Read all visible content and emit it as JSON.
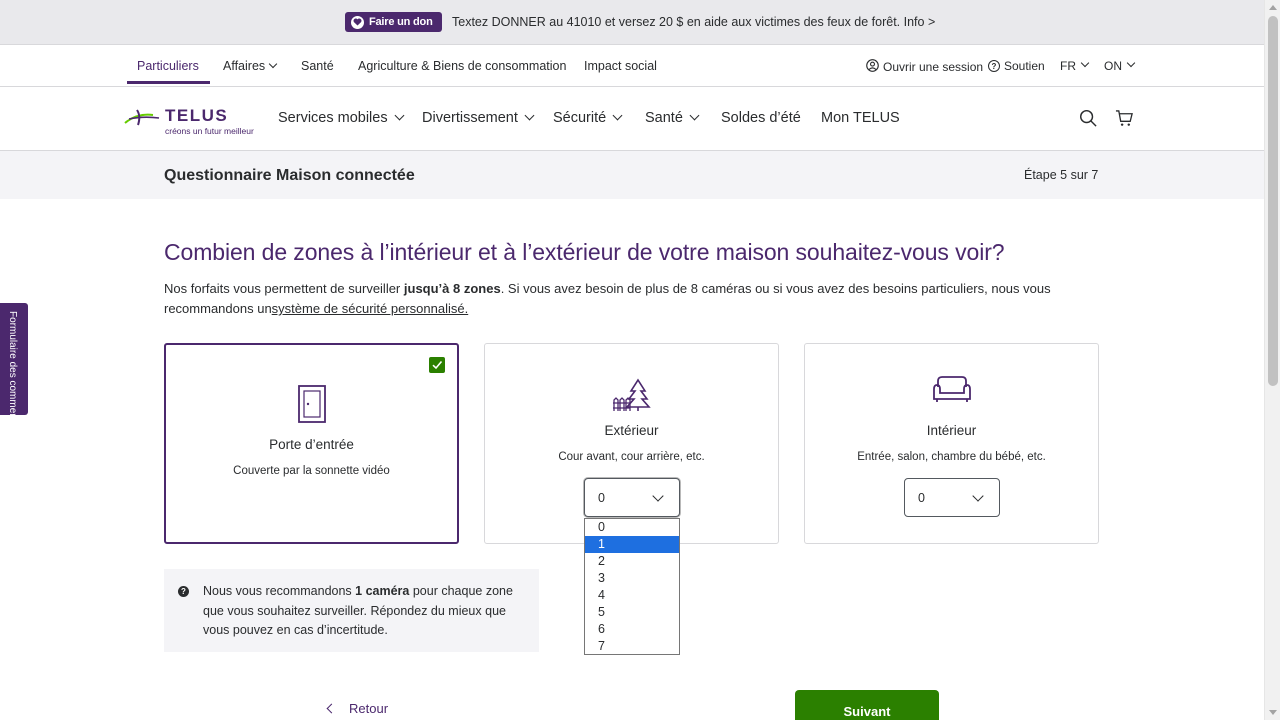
{
  "promo": {
    "donate_label": "Faire un don",
    "message": "Textez DONNER au 41010 et versez 20 $ en aide aux victimes des feux de forêt. Info >"
  },
  "subnav": {
    "items": [
      "Particuliers",
      "Affaires",
      "Santé",
      "Agriculture & Biens de consommation",
      "Impact social"
    ],
    "login": "Ouvrir une session",
    "support": "Soutien",
    "language": "FR",
    "province": "ON"
  },
  "brand": {
    "name": "TELUS",
    "tagline": "créons un futur meilleur",
    "accent": "#4b286d",
    "green": "#2b8000"
  },
  "mainnav": {
    "items": [
      "Services mobiles",
      "Divertissement",
      "Sécurité",
      "Santé",
      "Soldes d’été",
      "Mon TELUS"
    ]
  },
  "questionnaire": {
    "title": "Questionnaire Maison connectée",
    "step": "Étape 5 sur 7"
  },
  "content": {
    "heading": "Combien de zones à l’intérieur et à l’extérieur de votre maison souhaitez-vous voir?",
    "intro_before": "Nos forfaits vous permettent de surveiller ",
    "intro_bold": "jusqu’à 8 zones",
    "intro_after": ". Si vous avez besoin de plus de 8 caméras ou si vous avez des besoins particuliers, nous vous recommandons un",
    "intro_link": "système de sécurité personnalisé."
  },
  "cards": [
    {
      "icon": "door-icon",
      "title": "Porte d’entrée",
      "subtitle": "Couverte par la sonnette vidéo",
      "selected": true
    },
    {
      "icon": "trees-fence-icon",
      "title": "Extérieur",
      "subtitle": "Cour avant, cour arrière, etc.",
      "value": "0"
    },
    {
      "icon": "sofa-icon",
      "title": "Intérieur",
      "subtitle": "Entrée, salon, chambre du bébé, etc.",
      "value": "0"
    }
  ],
  "dropdown": {
    "options": [
      "0",
      "1",
      "2",
      "3",
      "4",
      "5",
      "6",
      "7"
    ],
    "highlighted": "1"
  },
  "tip": {
    "before": "Nous vous recommandons ",
    "bold": "1 caméra",
    "after": " pour chaque zone que vous souhaitez surveiller. Répondez du mieux que vous pouvez en cas d’incertitude."
  },
  "actions": {
    "back": "Retour",
    "next": "Suivant"
  },
  "feedback": {
    "label": "Formulaire des comment"
  }
}
